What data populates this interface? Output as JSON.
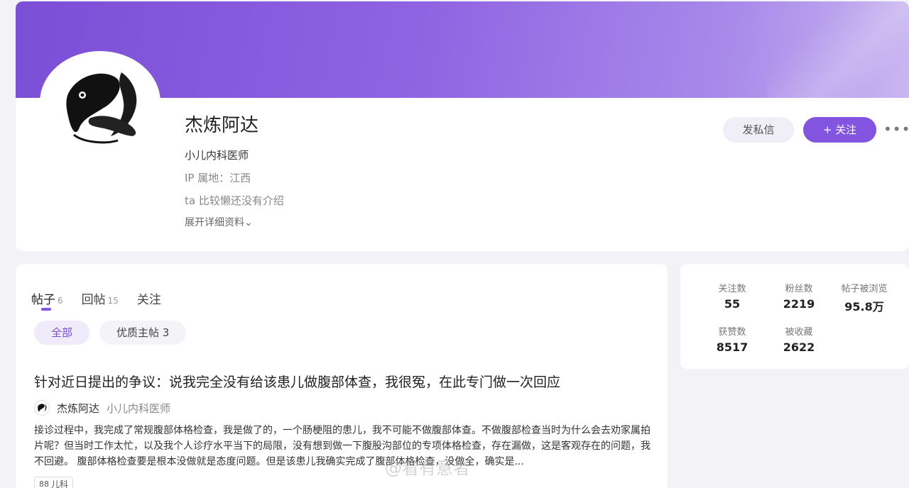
{
  "profile": {
    "name": "杰炼阿达",
    "title": "小儿内科医师",
    "ip_location": "IP 属地：江西",
    "bio": "ta 比较懒还没有介绍",
    "expand_label": "展开详细资料",
    "expand_chevron": "⌄",
    "message_button": "发私信",
    "follow_button": "+ 关注",
    "more_button": "•••"
  },
  "tabs": [
    {
      "label": "帖子",
      "count": "6"
    },
    {
      "label": "回帖",
      "count": "15"
    },
    {
      "label": "关注",
      "count": ""
    }
  ],
  "filters": [
    {
      "label": "全部"
    },
    {
      "label": "优质主帖 3"
    }
  ],
  "post": {
    "title": "针对近日提出的争议：说我完全没有给该患儿做腹部体查，我很冤，在此专门做一次回应",
    "author_name": "杰炼阿达",
    "author_title": "小儿内科医师",
    "body": "接诊过程中，我完成了常规腹部体格检查，我是做了的，一个肠梗阻的患儿，我不可能不做腹部体查。不做腹部检查当时为什么会去劝家属拍片呢？但当时工作太忙，以及我个人诊疗水平当下的局限，没有想到做一下腹股沟部位的专项体格检查，存在漏做，这是客观存在的问题，我不回避。 腹部体格检查要是根本没做就是态度问题。但是该患儿我确实完成了腹部体格检查，没做全，确实是...",
    "tag": "儿科",
    "tag_icon": "88"
  },
  "watermark": "@看有意者",
  "stats": [
    {
      "label": "关注数",
      "value": "55"
    },
    {
      "label": "粉丝数",
      "value": "2219"
    },
    {
      "label": "帖子被浏览",
      "value": "95.8万"
    },
    {
      "label": "获赞数",
      "value": "8517"
    },
    {
      "label": "被收藏",
      "value": "2622"
    }
  ],
  "colors": {
    "accent": "#8354e0",
    "banner_start": "#7b4fd6",
    "banner_end": "#c9b7f0"
  }
}
